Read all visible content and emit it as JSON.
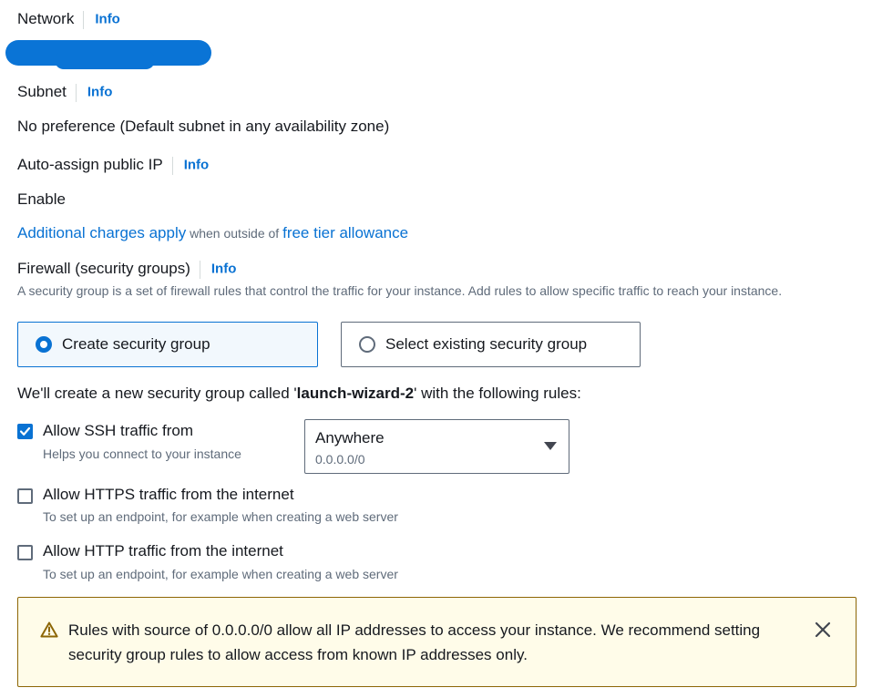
{
  "network": {
    "label": "Network",
    "info": "Info"
  },
  "subnet": {
    "label": "Subnet",
    "info": "Info",
    "value": "No preference (Default subnet in any availability zone)"
  },
  "auto_assign_ip": {
    "label": "Auto-assign public IP",
    "info": "Info",
    "value": "Enable"
  },
  "charges": {
    "link1": "Additional charges apply",
    "middle": " when outside of ",
    "link2": "free tier allowance"
  },
  "firewall": {
    "label": "Firewall (security groups)",
    "info": "Info",
    "description": "A security group is a set of firewall rules that control the traffic for your instance. Add rules to allow specific traffic to reach your instance.",
    "options": {
      "create": "Create security group",
      "existing": "Select existing security group"
    },
    "selected": "create",
    "create_note": {
      "prefix": "We'll create a new security group called '",
      "name": "launch-wizard-2",
      "suffix": "' with the following rules:"
    }
  },
  "rules": {
    "ssh": {
      "label": "Allow SSH traffic from",
      "description": "Helps you connect to your instance",
      "checked": true,
      "source": {
        "value": "Anywhere",
        "sub": "0.0.0.0/0"
      }
    },
    "https": {
      "label": "Allow HTTPS traffic from the internet",
      "description": "To set up an endpoint, for example when creating a web server",
      "checked": false
    },
    "http": {
      "label": "Allow HTTP traffic from the internet",
      "description": "To set up an endpoint, for example when creating a web server",
      "checked": false
    }
  },
  "alert": {
    "text": "Rules with source of 0.0.0.0/0 allow all IP addresses to access your instance. We recommend setting security group rules to allow access from known IP addresses only."
  },
  "icons": {
    "radio_selected": "radio-selected-icon",
    "radio_unselected": "radio-unselected-icon",
    "check": "checkmark-icon",
    "caret": "caret-down-icon",
    "warning": "warning-icon",
    "close": "close-icon"
  },
  "colors": {
    "link": "#0972d3",
    "text": "#16191f",
    "secondary_text": "#5f6b7a",
    "selected_tile_bg": "#f2f8fd",
    "alert_bg": "#fffce9",
    "alert_border": "#8d6605",
    "redaction": "#0a74d6"
  }
}
